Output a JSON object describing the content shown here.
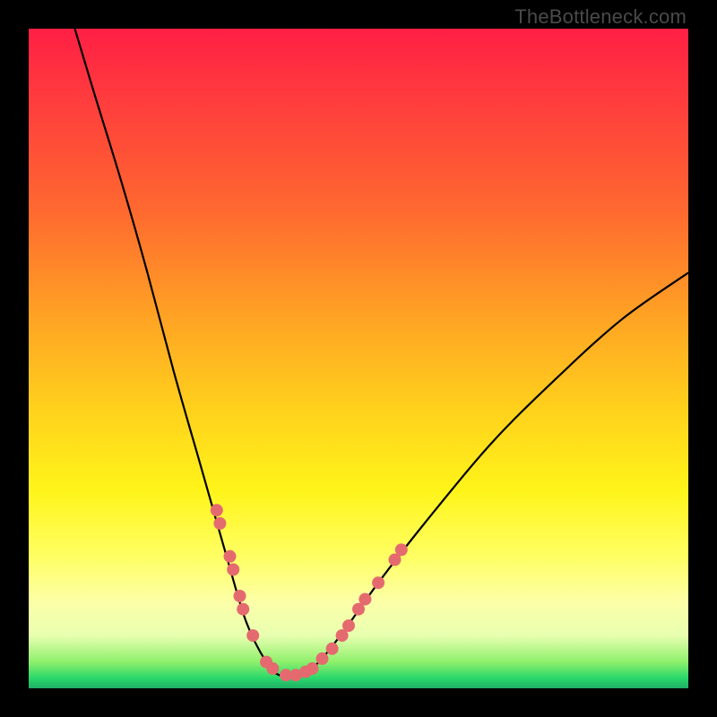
{
  "attribution": "TheBottleneck.com",
  "chart_data": {
    "type": "line",
    "title": "",
    "xlabel": "",
    "ylabel": "",
    "xlim": [
      0,
      100
    ],
    "ylim": [
      0,
      100
    ],
    "gradient_bands": [
      {
        "name": "red",
        "approx_y_pct_from_top": [
          0,
          25
        ]
      },
      {
        "name": "orange",
        "approx_y_pct_from_top": [
          25,
          50
        ]
      },
      {
        "name": "yellow",
        "approx_y_pct_from_top": [
          50,
          85
        ]
      },
      {
        "name": "pale",
        "approx_y_pct_from_top": [
          85,
          95
        ]
      },
      {
        "name": "green",
        "approx_y_pct_from_top": [
          95,
          100
        ]
      }
    ],
    "curve_note": "V-shaped bottleneck curve; left arm steeper than right; trough near x≈38%, y≈2% from bottom (green band)",
    "curve_points_pct": [
      {
        "x": 7,
        "y": 100
      },
      {
        "x": 10,
        "y": 90
      },
      {
        "x": 14,
        "y": 77
      },
      {
        "x": 18,
        "y": 63
      },
      {
        "x": 22,
        "y": 48
      },
      {
        "x": 26,
        "y": 34
      },
      {
        "x": 30,
        "y": 20
      },
      {
        "x": 33,
        "y": 10
      },
      {
        "x": 36,
        "y": 4
      },
      {
        "x": 38,
        "y": 2
      },
      {
        "x": 41,
        "y": 2
      },
      {
        "x": 44,
        "y": 4
      },
      {
        "x": 48,
        "y": 9
      },
      {
        "x": 53,
        "y": 16
      },
      {
        "x": 60,
        "y": 25
      },
      {
        "x": 70,
        "y": 37
      },
      {
        "x": 80,
        "y": 47
      },
      {
        "x": 90,
        "y": 56
      },
      {
        "x": 100,
        "y": 63
      }
    ],
    "markers_pct": [
      {
        "x": 28.5,
        "y": 27
      },
      {
        "x": 29,
        "y": 25
      },
      {
        "x": 30.5,
        "y": 20
      },
      {
        "x": 31,
        "y": 18
      },
      {
        "x": 32,
        "y": 14
      },
      {
        "x": 32.5,
        "y": 12
      },
      {
        "x": 34,
        "y": 8
      },
      {
        "x": 36,
        "y": 4
      },
      {
        "x": 37,
        "y": 3
      },
      {
        "x": 39,
        "y": 2
      },
      {
        "x": 40.5,
        "y": 2
      },
      {
        "x": 42,
        "y": 2.5
      },
      {
        "x": 43,
        "y": 3
      },
      {
        "x": 44.5,
        "y": 4.5
      },
      {
        "x": 46,
        "y": 6
      },
      {
        "x": 47.5,
        "y": 8
      },
      {
        "x": 48.5,
        "y": 9.5
      },
      {
        "x": 50,
        "y": 12
      },
      {
        "x": 51,
        "y": 13.5
      },
      {
        "x": 53,
        "y": 16
      },
      {
        "x": 55.5,
        "y": 19.5
      },
      {
        "x": 56.5,
        "y": 21
      }
    ],
    "marker_color": "#e56a6f",
    "marker_radius_px": 7
  }
}
